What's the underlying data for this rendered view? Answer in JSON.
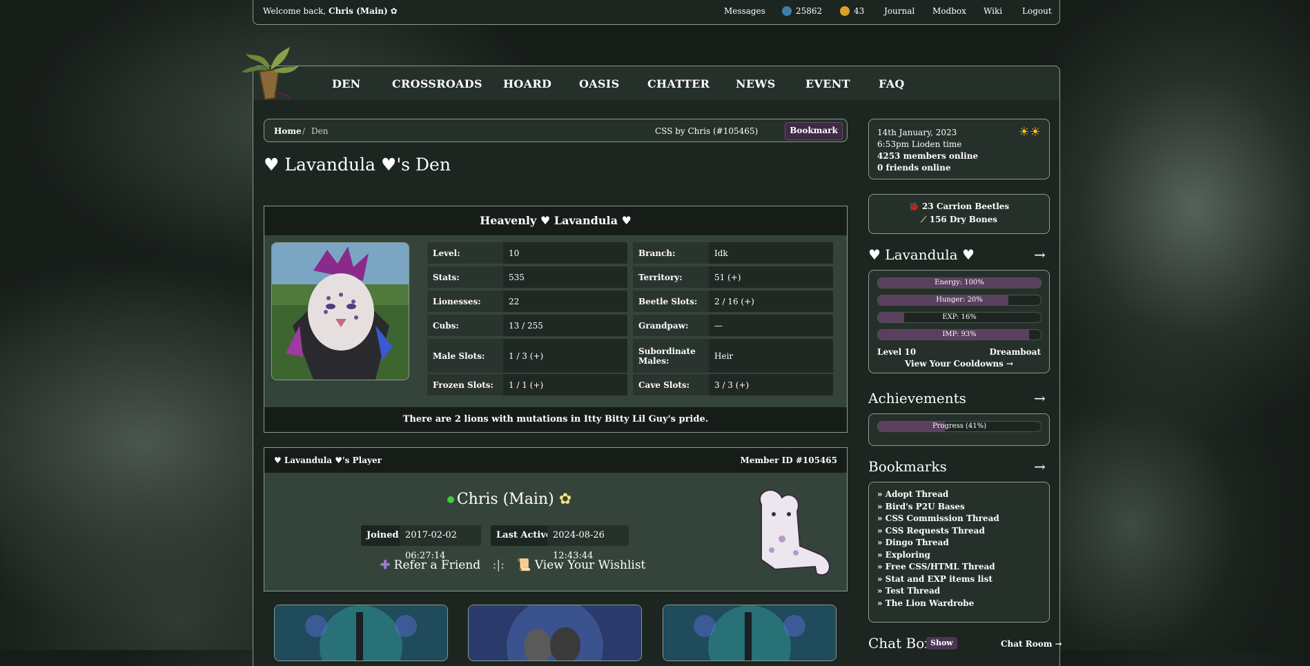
{
  "topbar": {
    "welcome_prefix": "Welcome back,",
    "username": "Chris (Main)",
    "messages": "Messages",
    "beetles": "25862",
    "bones": "43",
    "journal": "Journal",
    "modbox": "Modbox",
    "wiki": "Wiki",
    "logout": "Logout"
  },
  "nav": [
    "DEN",
    "CROSSROADS",
    "HOARD",
    "OASIS",
    "CHATTER",
    "NEWS",
    "EVENT",
    "FAQ"
  ],
  "breadcrumb": {
    "home": "Home",
    "sep": "/",
    "current": "Den",
    "css_credit": "CSS by Chris (#105465)",
    "bookmark": "Bookmark"
  },
  "page_title": "♥ Lavandula ♥'s Den",
  "lion": {
    "title": "Heavenly ♥ Lavandula ♥",
    "stats": [
      {
        "label": "Level:",
        "value": "10"
      },
      {
        "label": "Branch:",
        "value": "Idk"
      },
      {
        "label": "Stats:",
        "value": "535"
      },
      {
        "label": "Territory:",
        "value": "51 (+)"
      },
      {
        "label": "Lionesses:",
        "value": "22"
      },
      {
        "label": "Beetle Slots:",
        "value": "2 / 16 (+)"
      },
      {
        "label": "Cubs:",
        "value": "13 / 255"
      },
      {
        "label": "Grandpaw:",
        "value": "—"
      },
      {
        "label": "Male Slots:",
        "value": "1 / 3 (+)"
      },
      {
        "label": "Subordinate Males:",
        "value": "Heir"
      },
      {
        "label": "Frozen Slots:",
        "value": "1 / 1 (+)"
      },
      {
        "label": "Cave Slots:",
        "value": "3 / 3 (+)"
      }
    ],
    "mutation_note": "There are 2 lions with mutations in Itty Bitty Lil Guy's pride."
  },
  "player": {
    "title": "♥ Lavandula ♥'s Player",
    "member_id": "Member ID #105465",
    "name": "Chris (Main)",
    "joined_label": "Joined:",
    "joined_value": "2017-02-02 06:27:14",
    "active_label": "Last Active:",
    "active_value": "2024-08-26 12:43:44",
    "refer": "Refer a Friend",
    "divider": ":|:",
    "wishlist": "View Your Wishlist"
  },
  "sidebar": {
    "date": "14th January, 2023",
    "time": "6:53pm Lioden time",
    "members": "4253 members online",
    "friends": "0 friends online",
    "currency1": "23 Carrion Beetles",
    "currency2": "156 Dry Bones",
    "lion_name": "♥ Lavandula ♥",
    "arrow": "→",
    "bars": [
      {
        "label": "Energy: 100%",
        "pct": 100
      },
      {
        "label": "Hunger: 20%",
        "pct": 80
      },
      {
        "label": "EXP: 16%",
        "pct": 16
      },
      {
        "label": "IMP: 93%",
        "pct": 93
      }
    ],
    "level": "Level 10",
    "status": "Dreamboat",
    "cooldowns": "View Your Cooldowns →",
    "achievements_title": "Achievements",
    "progress": {
      "label": "Progress (41%)",
      "pct": 41
    },
    "bookmarks_title": "Bookmarks",
    "bookmarks": [
      "» Adopt Thread",
      "» Bird's P2U Bases",
      "» CSS Commission Thread",
      "» CSS Requests Thread",
      "» Dingo Thread",
      "» Exploring",
      "» Free CSS/HTML Thread",
      "» Stat and EXP items list",
      "» Test Thread",
      "» The Lion Wardrobe"
    ],
    "chat_title": "Chat Box",
    "chat_show": "Show",
    "chat_room": "Chat Room →"
  },
  "colors": {
    "accent": "#5a3f5f",
    "panel": "#26302a",
    "border": "#8c9a90",
    "online": "#3ecf3e"
  }
}
